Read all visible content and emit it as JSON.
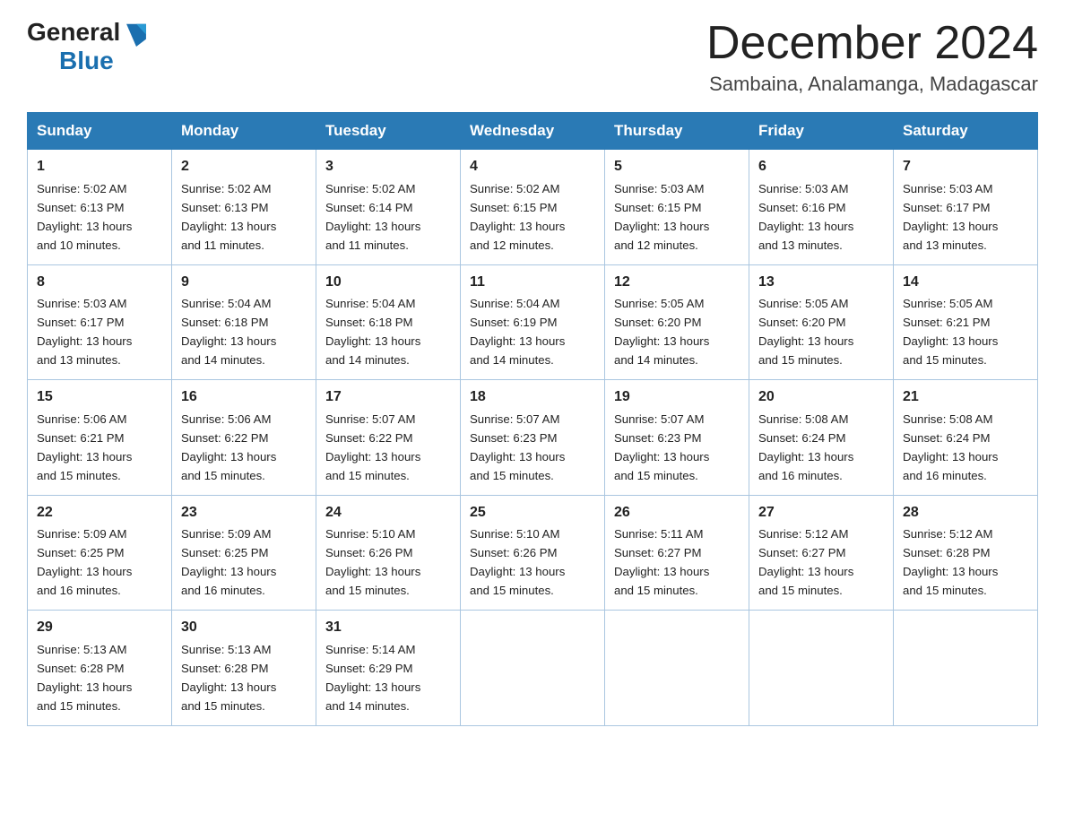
{
  "header": {
    "logo_general": "General",
    "logo_blue": "Blue",
    "month_title": "December 2024",
    "location": "Sambaina, Analamanga, Madagascar"
  },
  "weekdays": [
    "Sunday",
    "Monday",
    "Tuesday",
    "Wednesday",
    "Thursday",
    "Friday",
    "Saturday"
  ],
  "weeks": [
    [
      {
        "day": "1",
        "sunrise": "5:02 AM",
        "sunset": "6:13 PM",
        "daylight": "13 hours and 10 minutes."
      },
      {
        "day": "2",
        "sunrise": "5:02 AM",
        "sunset": "6:13 PM",
        "daylight": "13 hours and 11 minutes."
      },
      {
        "day": "3",
        "sunrise": "5:02 AM",
        "sunset": "6:14 PM",
        "daylight": "13 hours and 11 minutes."
      },
      {
        "day": "4",
        "sunrise": "5:02 AM",
        "sunset": "6:15 PM",
        "daylight": "13 hours and 12 minutes."
      },
      {
        "day": "5",
        "sunrise": "5:03 AM",
        "sunset": "6:15 PM",
        "daylight": "13 hours and 12 minutes."
      },
      {
        "day": "6",
        "sunrise": "5:03 AM",
        "sunset": "6:16 PM",
        "daylight": "13 hours and 13 minutes."
      },
      {
        "day": "7",
        "sunrise": "5:03 AM",
        "sunset": "6:17 PM",
        "daylight": "13 hours and 13 minutes."
      }
    ],
    [
      {
        "day": "8",
        "sunrise": "5:03 AM",
        "sunset": "6:17 PM",
        "daylight": "13 hours and 13 minutes."
      },
      {
        "day": "9",
        "sunrise": "5:04 AM",
        "sunset": "6:18 PM",
        "daylight": "13 hours and 14 minutes."
      },
      {
        "day": "10",
        "sunrise": "5:04 AM",
        "sunset": "6:18 PM",
        "daylight": "13 hours and 14 minutes."
      },
      {
        "day": "11",
        "sunrise": "5:04 AM",
        "sunset": "6:19 PM",
        "daylight": "13 hours and 14 minutes."
      },
      {
        "day": "12",
        "sunrise": "5:05 AM",
        "sunset": "6:20 PM",
        "daylight": "13 hours and 14 minutes."
      },
      {
        "day": "13",
        "sunrise": "5:05 AM",
        "sunset": "6:20 PM",
        "daylight": "13 hours and 15 minutes."
      },
      {
        "day": "14",
        "sunrise": "5:05 AM",
        "sunset": "6:21 PM",
        "daylight": "13 hours and 15 minutes."
      }
    ],
    [
      {
        "day": "15",
        "sunrise": "5:06 AM",
        "sunset": "6:21 PM",
        "daylight": "13 hours and 15 minutes."
      },
      {
        "day": "16",
        "sunrise": "5:06 AM",
        "sunset": "6:22 PM",
        "daylight": "13 hours and 15 minutes."
      },
      {
        "day": "17",
        "sunrise": "5:07 AM",
        "sunset": "6:22 PM",
        "daylight": "13 hours and 15 minutes."
      },
      {
        "day": "18",
        "sunrise": "5:07 AM",
        "sunset": "6:23 PM",
        "daylight": "13 hours and 15 minutes."
      },
      {
        "day": "19",
        "sunrise": "5:07 AM",
        "sunset": "6:23 PM",
        "daylight": "13 hours and 15 minutes."
      },
      {
        "day": "20",
        "sunrise": "5:08 AM",
        "sunset": "6:24 PM",
        "daylight": "13 hours and 16 minutes."
      },
      {
        "day": "21",
        "sunrise": "5:08 AM",
        "sunset": "6:24 PM",
        "daylight": "13 hours and 16 minutes."
      }
    ],
    [
      {
        "day": "22",
        "sunrise": "5:09 AM",
        "sunset": "6:25 PM",
        "daylight": "13 hours and 16 minutes."
      },
      {
        "day": "23",
        "sunrise": "5:09 AM",
        "sunset": "6:25 PM",
        "daylight": "13 hours and 16 minutes."
      },
      {
        "day": "24",
        "sunrise": "5:10 AM",
        "sunset": "6:26 PM",
        "daylight": "13 hours and 15 minutes."
      },
      {
        "day": "25",
        "sunrise": "5:10 AM",
        "sunset": "6:26 PM",
        "daylight": "13 hours and 15 minutes."
      },
      {
        "day": "26",
        "sunrise": "5:11 AM",
        "sunset": "6:27 PM",
        "daylight": "13 hours and 15 minutes."
      },
      {
        "day": "27",
        "sunrise": "5:12 AM",
        "sunset": "6:27 PM",
        "daylight": "13 hours and 15 minutes."
      },
      {
        "day": "28",
        "sunrise": "5:12 AM",
        "sunset": "6:28 PM",
        "daylight": "13 hours and 15 minutes."
      }
    ],
    [
      {
        "day": "29",
        "sunrise": "5:13 AM",
        "sunset": "6:28 PM",
        "daylight": "13 hours and 15 minutes."
      },
      {
        "day": "30",
        "sunrise": "5:13 AM",
        "sunset": "6:28 PM",
        "daylight": "13 hours and 15 minutes."
      },
      {
        "day": "31",
        "sunrise": "5:14 AM",
        "sunset": "6:29 PM",
        "daylight": "13 hours and 14 minutes."
      },
      null,
      null,
      null,
      null
    ]
  ],
  "labels": {
    "sunrise": "Sunrise:",
    "sunset": "Sunset:",
    "daylight": "Daylight:"
  }
}
